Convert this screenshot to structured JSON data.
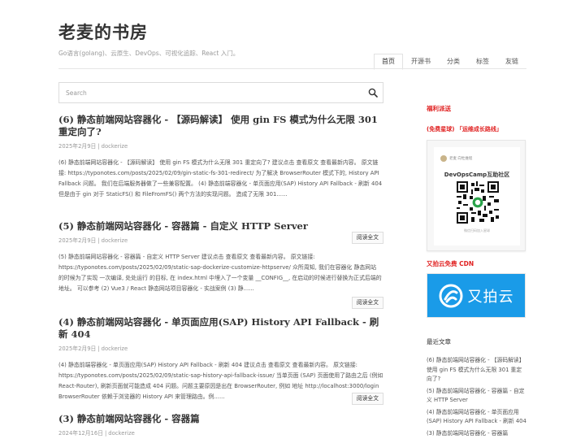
{
  "site": {
    "title": "老麦的书房",
    "description": "Go语言(golang)、云原生、DevOps、可视化追踪、React 入门。"
  },
  "nav": {
    "items": [
      {
        "label": "首页",
        "active": true
      },
      {
        "label": "开源书",
        "active": false
      },
      {
        "label": "分类",
        "active": false
      },
      {
        "label": "标签",
        "active": false
      },
      {
        "label": "友链",
        "active": false
      }
    ]
  },
  "search": {
    "placeholder": "Search",
    "icon": "search-icon"
  },
  "posts": [
    {
      "title": "(6) 静态前端网站容器化 - 【源码解读】 使用 gin FS 模式为什么无限 301 重定向了?",
      "date": "2025年2月9日",
      "author": "dockerize",
      "excerpt": "(6) 静态前端网站容器化 - 【源码解读】 使用 gin FS 模式为什么无限 301 重定向了? 建议点击 查看原文 查看最新内容。 原文链接: https://typonotes.com/posts/2025/02/09/gin-static-fs-301-redirect/ 为了解决 BrowserRouter 模式下的, History API Fallback 问题。 我们在后端服务器做了一些兼容配置。 (4) 静态前端容器化 - 单页面应用(SAP) History API Fallback - 刷新 404 但是由于 gin 对于 StaticFS() 和 FileFromFS() 两个方法的实现问题。 造成了无限 301......",
      "read_more": "阅读全文"
    },
    {
      "title": "(5) 静态前端网站容器化 - 容器篇 - 自定义 HTTP Server",
      "date": "2025年2月9日",
      "author": "dockerize",
      "excerpt": "(5) 静态前端网站容器化 - 容器篇 - 自定义 HTTP Server 建议点击 查看原文 查看最新内容。 原文链接: https://typonotes.com/posts/2025/02/09/static-sap-dockerize-customize-httpserve/ 众所周知, 我们在容器化 静态网站 的时候为了实现 一次编译, 处处运行 的目标, 在 index.html 中埋入了一个变量 __CONFIG__, 在启动的时候进行替换为正式后端的地址。 可以参考 (2) Vue3 / React 静态网站项目容器化 - 实战案例 (3) 静......",
      "read_more": "阅读全文"
    },
    {
      "title": "(4) 静态前端网站容器化 - 单页面应用(SAP) History API Fallback - 刷新 404",
      "date": "2025年2月9日",
      "author": "dockerize",
      "excerpt": "(4) 静态前端容器化 - 单页面应用(SAP) History API Fallback - 刷新 404 建议点击 查看原文 查看最新内容。 原文链接: https://typonotes.com/posts/2025/02/09/static-sap-history-api-fallback-issue/ 当单页面 (SAP) 页面使用了路由之后 (例如 React-Router), 刷新页面就可能造成 404 问题。问题主要原因是出在 BrowserRouter, 例如 地址 http://localhost:3000/login BrowserRouter 依赖于浏览器的 History API 来管理路由。例......",
      "read_more": "阅读全文"
    },
    {
      "title": "(3) 静态前端网站容器化 - 容器篇",
      "date": "2024年12月16日",
      "author": "dockerize",
      "excerpt": "",
      "read_more": ""
    }
  ],
  "sidebar": {
    "welfare_title": "福利派送",
    "promo_text": "(免费星球) 「运维成长路线」",
    "qr_card": {
      "account": "老麦 向牡维程",
      "name": "DevOpsCamp互助社区",
      "note": "微信扫码加入星球"
    },
    "upyun_title": "又拍云免费 CDN",
    "upyun_logo_text": "又拍云",
    "recent_title": "最近文章",
    "recent_posts": [
      "(6) 静态前端网站容器化 - 【源码解读】 使用 gin FS 模式为什么无限 301 重定向了?",
      "(5) 静态前端网站容器化 - 容器篇 - 自定义 HTTP Server",
      "(4) 静态前端网站容器化 - 单页面应用(SAP) History API Fallback - 刷新 404",
      "(3) 静态前端网站容器化 - 容器篇"
    ]
  },
  "colors": {
    "accent": "#e02020",
    "upyun": "#1a9be8"
  }
}
